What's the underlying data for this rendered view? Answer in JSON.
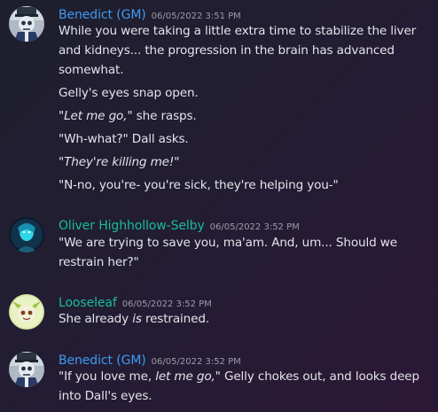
{
  "colors": {
    "benedict": "#3d9cf0",
    "oliver": "#1abc9c",
    "looseleaf": "#1abc9c"
  },
  "messages": [
    {
      "author": "Benedict (GM)",
      "timestamp": "06/05/2022 3:51 PM",
      "avatar_icon": "skeleton-doctor-avatar",
      "lines": [
        "While you were taking a little extra time to stabilize the liver",
        "and kidneys... the progression in the brain has advanced",
        "somewhat.",
        "Gelly's eyes snap open.",
        "\"Let me go,\"",
        " she rasps.",
        "\"Wh-what?\" Dall asks.",
        "\"They're killing me!\"",
        "\"N-no, you're- you're sick, they're helping you-\""
      ]
    },
    {
      "author": "Oliver Highhollow-Selby",
      "timestamp": "06/05/2022 3:52 PM",
      "avatar_icon": "glowing-figure-avatar",
      "lines": [
        "\"We are trying to save you, ma'am. And, um... Should we",
        "restrain her?\""
      ]
    },
    {
      "author": "Looseleaf",
      "timestamp": "06/05/2022 3:52 PM",
      "avatar_icon": "leaf-creature-avatar",
      "lines": [
        "She already ",
        "is",
        " restrained."
      ]
    },
    {
      "author": "Benedict (GM)",
      "timestamp": "06/05/2022 3:52 PM",
      "avatar_icon": "skeleton-doctor-avatar",
      "lines": [
        "\"If you love me, ",
        "let me go,\"",
        " Gelly chokes out, and looks deep",
        "into Dall's eyes."
      ]
    }
  ]
}
